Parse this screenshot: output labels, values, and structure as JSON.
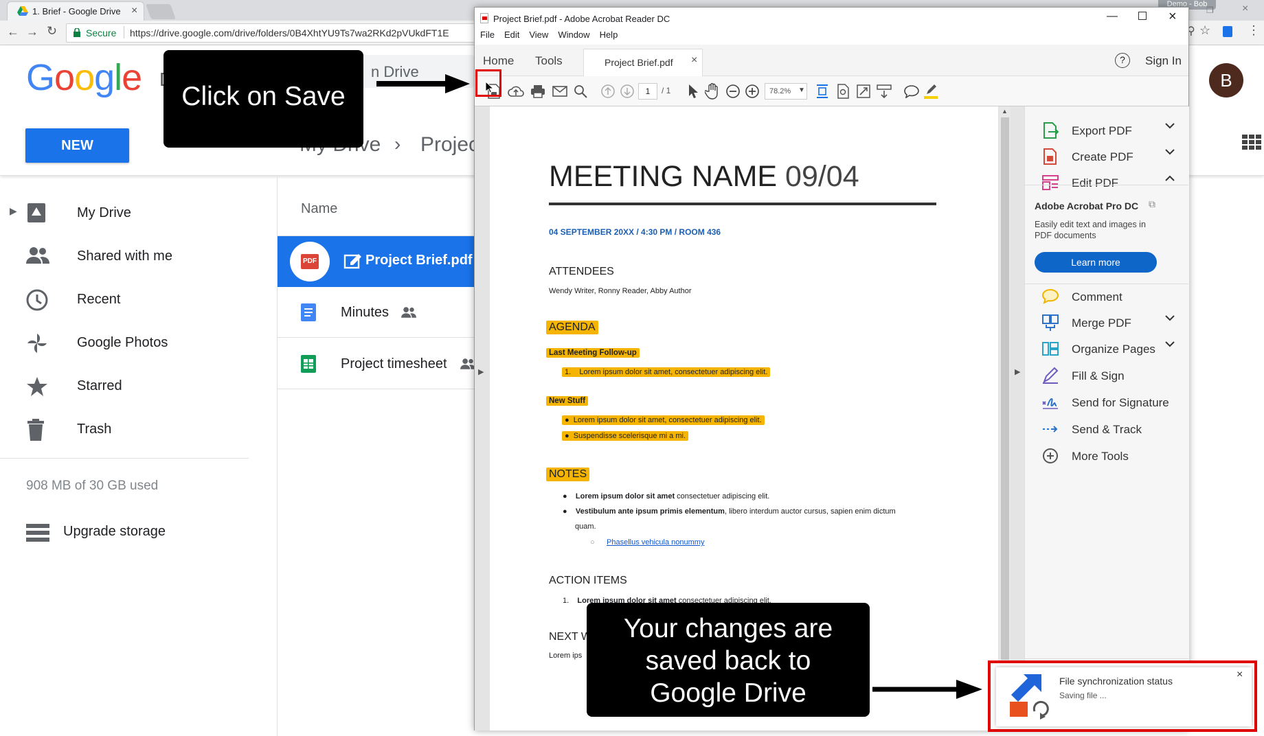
{
  "browser": {
    "tab_title": "1. Brief - Google Drive",
    "secure_label": "Secure",
    "url": "https://drive.google.com/drive/folders/0B4XhtYU9Ts7wa2RKd2pVUkdFT1E",
    "profile_label": "Demo - Bob"
  },
  "drive": {
    "logo_text": "Google",
    "search_partial": "n Drive",
    "new_button": "NEW",
    "breadcrumb_root": "My Drive",
    "breadcrumb_child": "Projec",
    "avatar_letter": "B",
    "name_column": "Name",
    "sidebar": [
      {
        "label": "My Drive",
        "icon": "drive-icon"
      },
      {
        "label": "Shared with me",
        "icon": "people-icon"
      },
      {
        "label": "Recent",
        "icon": "clock-icon"
      },
      {
        "label": "Google Photos",
        "icon": "photos-icon"
      },
      {
        "label": "Starred",
        "icon": "star-icon"
      },
      {
        "label": "Trash",
        "icon": "trash-icon"
      }
    ],
    "storage": "908 MB of 30 GB used",
    "upgrade": "Upgrade storage",
    "files": [
      {
        "name": "Project Brief.pdf",
        "type": "pdf",
        "selected": true
      },
      {
        "name": "Minutes",
        "type": "doc",
        "shared": true
      },
      {
        "name": "Project timesheet",
        "type": "sheet",
        "shared": true
      }
    ]
  },
  "acrobat": {
    "title": "Project Brief.pdf - Adobe Acrobat Reader DC",
    "menu": [
      "File",
      "Edit",
      "View",
      "Window",
      "Help"
    ],
    "nav_home": "Home",
    "nav_tools": "Tools",
    "doc_tab": "Project Brief.pdf",
    "sign_in": "Sign In",
    "page_current": "1",
    "page_total": "/ 1",
    "zoom": "78.2%",
    "right_panel": {
      "tools_top": [
        {
          "label": "Export PDF",
          "icon": "export-pdf-icon",
          "chevron": "down"
        },
        {
          "label": "Create PDF",
          "icon": "create-pdf-icon",
          "chevron": "down"
        },
        {
          "label": "Edit PDF",
          "icon": "edit-pdf-icon",
          "chevron": "up"
        }
      ],
      "promo_title": "Adobe Acrobat Pro DC",
      "promo_text": "Easily edit text and images in PDF documents",
      "learn_more": "Learn more",
      "tools_bottom": [
        {
          "label": "Comment",
          "icon": "comment-icon"
        },
        {
          "label": "Merge PDF",
          "icon": "merge-pdf-icon",
          "chevron": "down"
        },
        {
          "label": "Organize Pages",
          "icon": "organize-pages-icon",
          "chevron": "down"
        },
        {
          "label": "Fill & Sign",
          "icon": "fill-sign-icon"
        },
        {
          "label": "Send for Signature",
          "icon": "send-signature-icon"
        },
        {
          "label": "Send & Track",
          "icon": "send-track-icon"
        },
        {
          "label": "More Tools",
          "icon": "more-tools-icon"
        }
      ]
    }
  },
  "document": {
    "title_main": "MEETING NAME",
    "title_date": "09/04",
    "subtitle": "04 SEPTEMBER 20XX / 4:30 PM / ROOM 436",
    "attendees_heading": "ATTENDEES",
    "attendees": "Wendy Writer, Ronny Reader, Abby Author",
    "agenda_heading": "AGENDA",
    "followup_heading": "Last Meeting Follow-up",
    "followup_item": "Lorem ipsum dolor sit amet, consectetuer adipiscing elit.",
    "followup_num": "1.",
    "newstuff_heading": "New Stuff",
    "newstuff_items": [
      "Lorem ipsum dolor sit amet, consectetuer adipiscing elit.",
      "Suspendisse scelerisque mi a mi."
    ],
    "notes_heading": "NOTES",
    "note1_bold": "Lorem ipsum dolor sit amet",
    "note1_rest": " consectetuer adipiscing elit.",
    "note2_bold": "Vestibulum ante ipsum primis elementum",
    "note2_rest": ", libero interdum auctor cursus, sapien enim dictum",
    "note2_cont": "quam.",
    "note_link": "Phasellus vehicula nonummy",
    "action_heading": "ACTION ITEMS",
    "action_num": "1.",
    "action_bold": "Lorem ipsum dolor sit amet",
    "action_rest": " consectetuer adipiscing elit.",
    "next_partial": "NEXT W",
    "lorem_partial": "Lorem ips"
  },
  "callouts": {
    "save": "Click on Save",
    "saved_line1": "Your changes are",
    "saved_line2": "saved back to",
    "saved_line3": "Google Drive"
  },
  "sync": {
    "title": "File synchronization status",
    "status": "Saving file ..."
  },
  "colors": {
    "drive_blue": "#1a73e8",
    "highlight": "#f5b400",
    "callout_red": "#e00000",
    "acrobat_link": "#1155cc"
  }
}
